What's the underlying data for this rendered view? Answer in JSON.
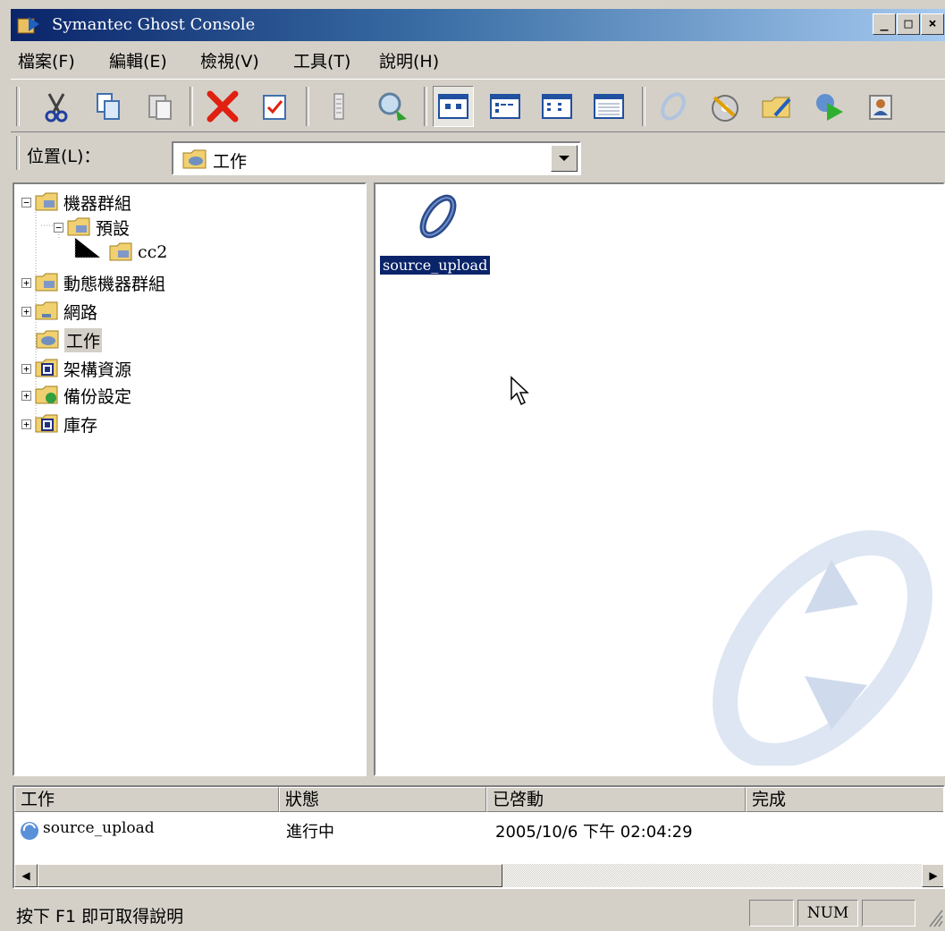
{
  "window": {
    "title": "Symantec Ghost Console",
    "caption_buttons": {
      "minimize": "_",
      "maximize": "□",
      "close": "×"
    }
  },
  "menu": [
    {
      "label": "檔案(F)"
    },
    {
      "label": "編輯(E)"
    },
    {
      "label": "檢視(V)"
    },
    {
      "label": "工具(T)"
    },
    {
      "label": "說明(H)"
    }
  ],
  "toolbar": [
    {
      "icon": "cut-icon"
    },
    {
      "icon": "copy-icon"
    },
    {
      "icon": "paste-icon"
    },
    {
      "icon": "delete-icon"
    },
    {
      "icon": "properties-icon"
    },
    {
      "icon": "column-icon"
    },
    {
      "icon": "find-icon"
    },
    {
      "icon": "large-icons-view-icon"
    },
    {
      "icon": "small-icons-view-icon"
    },
    {
      "icon": "list-view-icon"
    },
    {
      "icon": "details-view-icon"
    },
    {
      "icon": "new-task-icon"
    },
    {
      "icon": "image-create-icon"
    },
    {
      "icon": "image-edit-icon"
    },
    {
      "icon": "run-task-icon"
    },
    {
      "icon": "user-icon"
    }
  ],
  "location": {
    "label": "位置(L)：",
    "value": "工作"
  },
  "tree": [
    {
      "label": "機器群組",
      "expander": "−"
    },
    {
      "label": "預設",
      "expander": "−"
    },
    {
      "label": "cc2"
    },
    {
      "label": "動態機器群組",
      "expander": "+"
    },
    {
      "label": "網路",
      "expander": "+"
    },
    {
      "label": "工作"
    },
    {
      "label": "架構資源",
      "expander": "+"
    },
    {
      "label": "備份設定",
      "expander": "+"
    },
    {
      "label": "庫存",
      "expander": "+"
    }
  ],
  "content": {
    "item_label": "source_upload"
  },
  "tasks": {
    "columns": [
      "工作",
      "狀態",
      "已啓動",
      "完成"
    ],
    "rows": [
      {
        "task": "source_upload",
        "status": "進行中",
        "started": "2005/10/6 下午 02:04:29",
        "finished": ""
      }
    ]
  },
  "statusbar": {
    "help": "按下 F1 即可取得說明",
    "num": "NUM"
  },
  "colors": {
    "title_start": "#0a246a",
    "title_end": "#a6caf0",
    "face": "#d4d0c8",
    "selection": "#0a246a"
  }
}
